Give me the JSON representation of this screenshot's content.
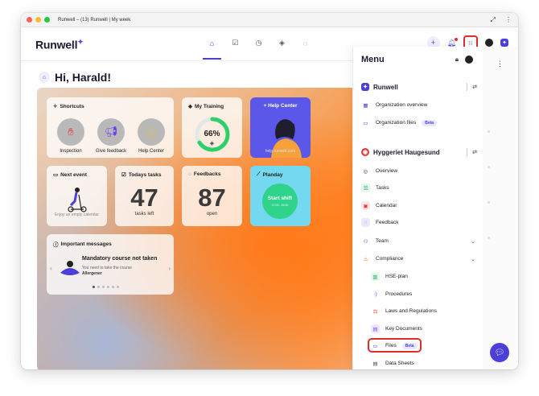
{
  "window": {
    "title": "Runwell – (13) Runwell | My week"
  },
  "brand": {
    "name": "Runwell"
  },
  "greeting": "Hi, Harald!",
  "shortcuts": {
    "title": "Shortcuts",
    "items": [
      {
        "label": "Inspection",
        "icon": "hand-stop-icon"
      },
      {
        "label": "Give feedback",
        "icon": "megaphone-icon"
      },
      {
        "label": "Help Center",
        "icon": "info-icon"
      }
    ]
  },
  "training": {
    "title": "My Training",
    "percent": "66%",
    "progress": 0.66
  },
  "help_center": {
    "title": "Help Center",
    "url": "help.runwell.com"
  },
  "next_event": {
    "title": "Next event",
    "empty_text": "Enjoy an empty calendar"
  },
  "todays_tasks": {
    "title": "Todays tasks",
    "count": "47",
    "sub": "tasks left"
  },
  "feedbacks": {
    "title": "Feedbacks",
    "count": "87",
    "sub": "open"
  },
  "planday": {
    "title": "Planday",
    "button": "Start shift",
    "time": "07:00 - 15:00"
  },
  "messages": {
    "title": "Important messages",
    "heading": "Mandatory course not taken",
    "body": "You need to take the course",
    "course": "Allergener"
  },
  "menu": {
    "title": "Menu",
    "org": {
      "name": "Runwell",
      "items": [
        {
          "label": "Organization overview"
        },
        {
          "label": "Organization files",
          "badge": "Beta"
        }
      ]
    },
    "unit": {
      "name": "Hyggeriet Haugesund",
      "items": [
        {
          "label": "Overview"
        },
        {
          "label": "Tasks"
        },
        {
          "label": "Calendar"
        },
        {
          "label": "Feedback"
        },
        {
          "label": "Team"
        },
        {
          "label": "Compliance"
        }
      ],
      "compliance_items": [
        {
          "label": "HSE-plan"
        },
        {
          "label": "Procedures"
        },
        {
          "label": "Laws and Regulations"
        },
        {
          "label": "Key Documents"
        },
        {
          "label": "Files",
          "badge": "Beta"
        },
        {
          "label": "Data Sheets"
        }
      ]
    }
  },
  "colors": {
    "accent": "#4b3fd8",
    "highlight": "#e02b2b",
    "planday_green": "#2fd38a",
    "help_blue": "#5b57e8"
  }
}
